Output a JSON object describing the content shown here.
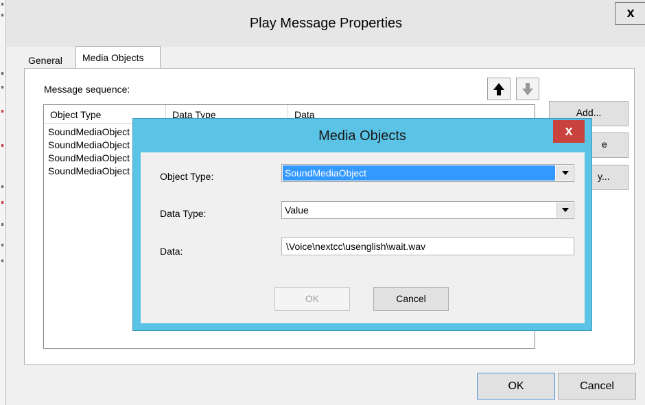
{
  "main_window": {
    "title": "Play Message Properties",
    "close_glyph": "x",
    "tabs": [
      {
        "label": "General",
        "selected": false
      },
      {
        "label": "Media Objects",
        "selected": true
      }
    ],
    "message_sequence_label": "Message sequence:",
    "list": {
      "columns": [
        "Object Type",
        "Data Type",
        "Data"
      ],
      "rows": [
        "SoundMediaObject",
        "SoundMediaObject",
        "SoundMediaObject",
        "SoundMediaObject"
      ]
    },
    "side_buttons": {
      "add": "Add...",
      "remove": "e",
      "modify": "y..."
    },
    "bottom_buttons": {
      "ok": "OK",
      "cancel": "Cancel"
    },
    "icons": {
      "move_up": "arrow-up-icon",
      "move_down": "arrow-down-icon"
    }
  },
  "modal": {
    "title": "Media Objects",
    "close_glyph": "x",
    "fields": {
      "object_type_label": "Object Type:",
      "object_type_value": "SoundMediaObject",
      "data_type_label": "Data Type:",
      "data_type_value": "Value",
      "data_label": "Data:",
      "data_value": "\\Voice\\nextcc\\usenglish\\wait.wav"
    },
    "buttons": {
      "ok": "OK",
      "cancel": "Cancel"
    },
    "colors": {
      "frame": "#5bc3e6",
      "close": "#c9423d",
      "selection": "#3399ff"
    }
  }
}
